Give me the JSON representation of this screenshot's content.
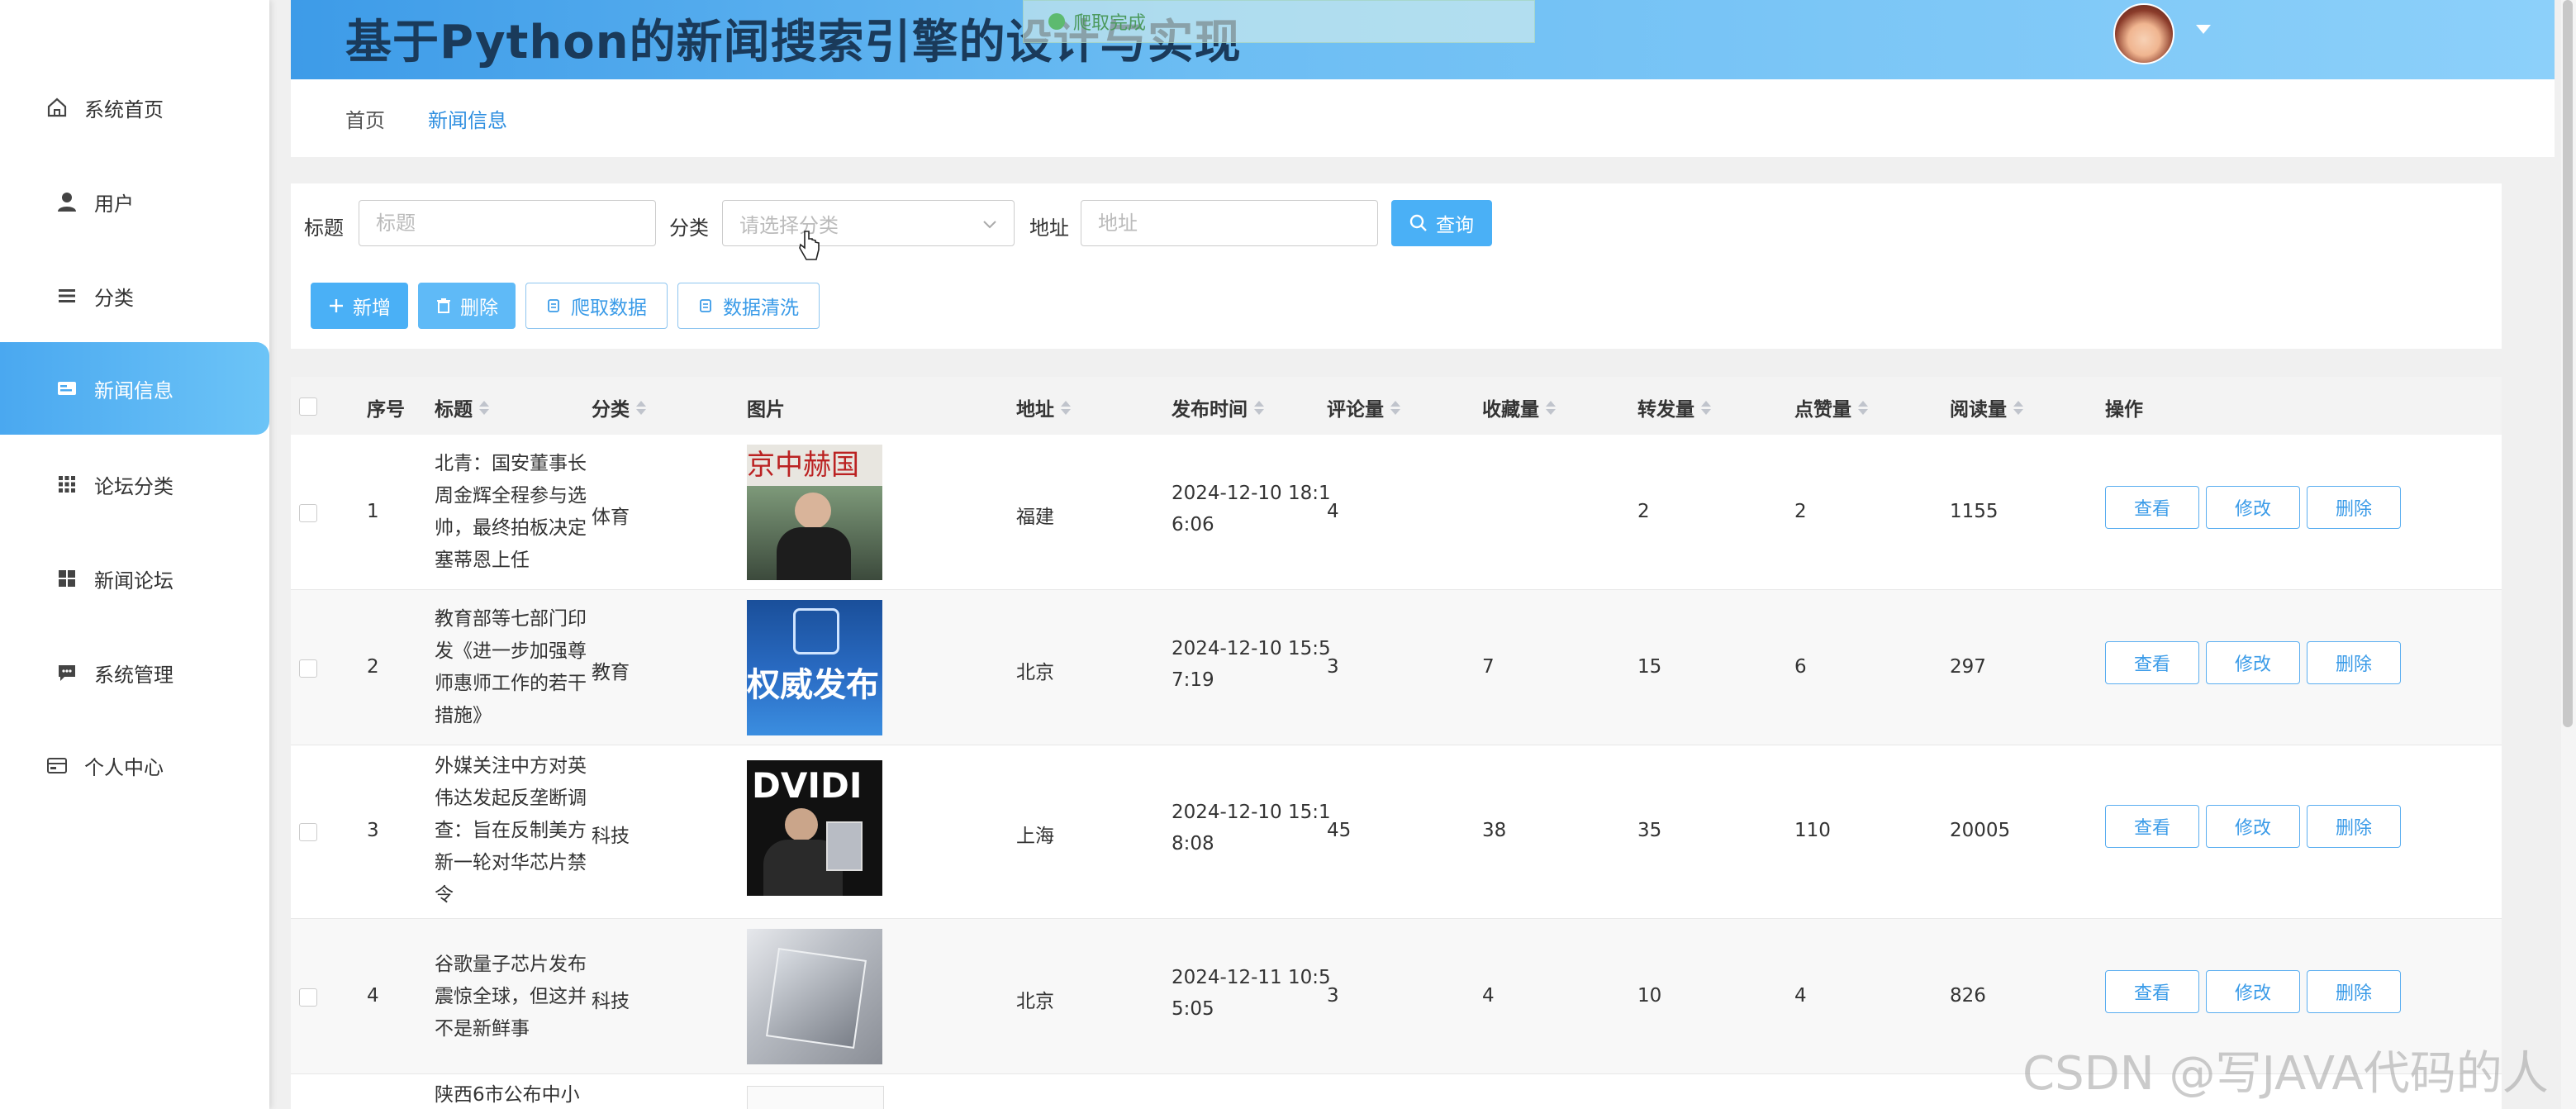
{
  "header": {
    "title": "基于Python的新闻搜索引擎的设计与实现",
    "toast": "爬取完成"
  },
  "sidebar": {
    "items": [
      {
        "label": "系统首页",
        "icon": "home-icon"
      },
      {
        "label": "用户",
        "icon": "user-icon"
      },
      {
        "label": "分类",
        "icon": "list-icon"
      },
      {
        "label": "新闻信息",
        "icon": "news-icon",
        "active": true
      },
      {
        "label": "论坛分类",
        "icon": "grid-icon"
      },
      {
        "label": "新闻论坛",
        "icon": "apps-icon"
      },
      {
        "label": "系统管理",
        "icon": "message-icon"
      },
      {
        "label": "个人中心",
        "icon": "card-icon"
      }
    ]
  },
  "breadcrumb": [
    "首页",
    "新闻信息"
  ],
  "filters": {
    "title_label": "标题",
    "title_placeholder": "标题",
    "category_label": "分类",
    "category_placeholder": "请选择分类",
    "address_label": "地址",
    "address_placeholder": "地址",
    "search_label": "查询"
  },
  "actions": {
    "add": "新增",
    "delete": "删除",
    "crawl": "爬取数据",
    "clean": "数据清洗"
  },
  "table": {
    "columns": [
      "序号",
      "标题",
      "分类",
      "图片",
      "地址",
      "发布时间",
      "评论量",
      "收藏量",
      "转发量",
      "点赞量",
      "阅读量",
      "操作"
    ],
    "row_actions": [
      "查看",
      "修改",
      "删除"
    ],
    "rows": [
      {
        "no": "1",
        "title": [
          "北青：国安董事长",
          "周金辉全程参与选",
          "帅，最终拍板决定",
          "塞蒂恩上任"
        ],
        "category": "体育",
        "image_text": "京中赫国",
        "address": "福建",
        "time": [
          "2024-12-10 18:1",
          "6:06"
        ],
        "comments": "4",
        "favorites": "",
        "shares": "2",
        "likes": "2",
        "reads": "1155"
      },
      {
        "no": "2",
        "title": [
          "教育部等七部门印",
          "发《进一步加强尊",
          "师惠师工作的若干",
          "措施》"
        ],
        "category": "教育",
        "image_text": "权威发布",
        "address": "北京",
        "time": [
          "2024-12-10 15:5",
          "7:19"
        ],
        "comments": "3",
        "favorites": "7",
        "shares": "15",
        "likes": "6",
        "reads": "297"
      },
      {
        "no": "3",
        "title": [
          "外媒关注中方对英",
          "伟达发起反垄断调",
          "查：旨在反制美方",
          "新一轮对华芯片禁",
          "令"
        ],
        "category": "科技",
        "image_text": "DVIDI",
        "address": "上海",
        "time": [
          "2024-12-10 15:1",
          "8:08"
        ],
        "comments": "45",
        "favorites": "38",
        "shares": "35",
        "likes": "110",
        "reads": "20005"
      },
      {
        "no": "4",
        "title": [
          "谷歌量子芯片发布",
          "震惊全球，但这并",
          "不是新鲜事"
        ],
        "category": "科技",
        "image_text": "",
        "address": "北京",
        "time": [
          "2024-12-11 10:5",
          "5:05"
        ],
        "comments": "3",
        "favorites": "4",
        "shares": "10",
        "likes": "4",
        "reads": "826"
      },
      {
        "no": "",
        "title": [
          "陕西6市公布中小"
        ],
        "category": "",
        "image_text": "",
        "address": "",
        "time": [
          "",
          ""
        ],
        "comments": "",
        "favorites": "",
        "shares": "",
        "likes": "",
        "reads": ""
      }
    ]
  },
  "watermark": "CSDN @写JAVA代码的人",
  "colors": {
    "accent": "#4ab0f6",
    "header_start": "#3d9be8",
    "header_end": "#8cd0fa",
    "sidebar_active": "#4aa8f0"
  }
}
